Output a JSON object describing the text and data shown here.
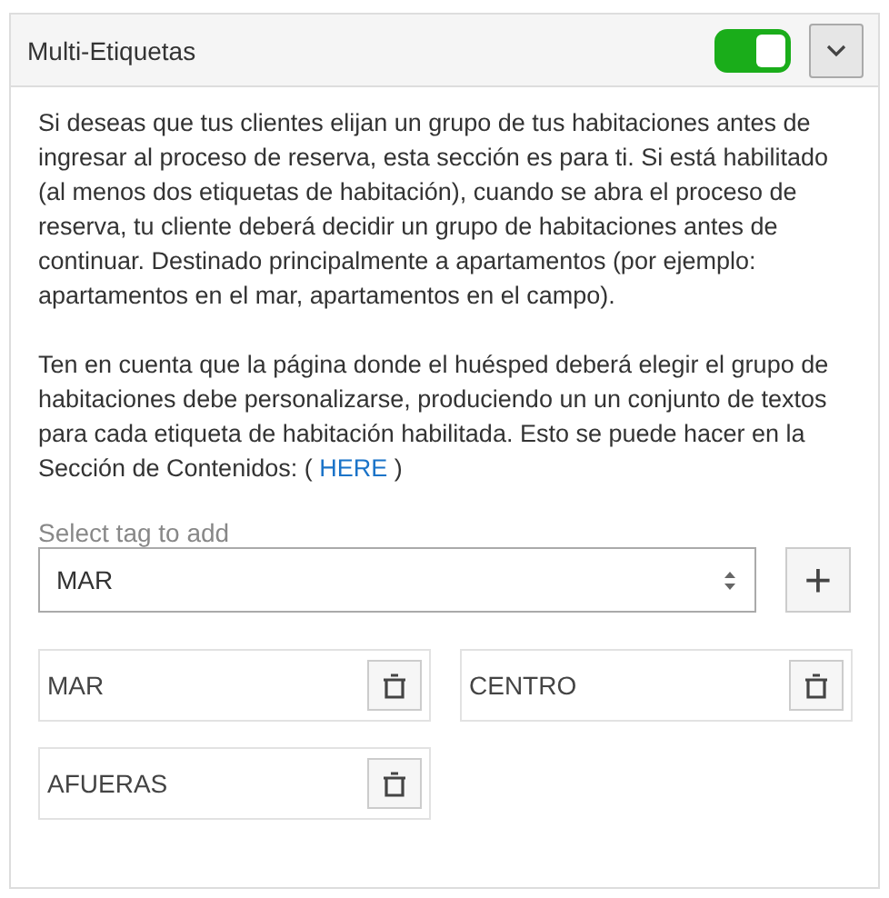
{
  "panel": {
    "title": "Multi-Etiquetas",
    "enabled": true,
    "expanded": true
  },
  "paragraphs": [
    {
      "text": "Si deseas que tus clientes elijan un grupo de tus habitaciones antes de ingresar al proceso de reserva, esta sección es para ti. Si está habilitado (al menos dos etiquetas de habitación), cuando se abra el proceso de reserva, tu cliente deberá decidir un grupo de habitaciones antes de continuar. Destinado principalmente a apartamentos (por ejemplo: apartamentos en el mar, apartamentos en el campo)."
    },
    {
      "text": "Ten en cuenta que la página donde el huésped deberá elegir el grupo de habitaciones debe personalizarse, produciendo un un conjunto de textos para cada etiqueta de habitación habilitada. Esto se puede hacer en la Sección de Contenidos: ( ",
      "link": "HERE",
      "after": " )"
    }
  ],
  "select": {
    "label": "Select tag to add",
    "value": "MAR",
    "add_button": "+"
  },
  "tags": [
    {
      "label": "MAR"
    },
    {
      "label": "CENTRO"
    },
    {
      "label": "AFUERAS"
    }
  ]
}
